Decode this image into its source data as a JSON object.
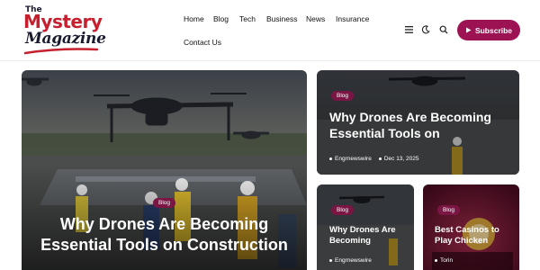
{
  "brand": {
    "logo_line1": "The",
    "logo_line2": "Mystery",
    "logo_line3": "Magazine",
    "accent": "#9c1253",
    "logo_red": "#c6202f"
  },
  "nav": {
    "items": [
      "Home",
      "Blog",
      "Tech",
      "Business",
      "News",
      "Insurance",
      "Contact Us"
    ]
  },
  "header_icons": [
    "menu-icon",
    "moon-icon",
    "search-icon"
  ],
  "subscribe": {
    "label": "Subscribe",
    "icon": "play-icon"
  },
  "featured": {
    "category": "Blog",
    "title": "Why Drones Are Becoming Essential Tools on Construction"
  },
  "side_top": {
    "category": "Blog",
    "title": "Why Drones Are Becoming Essential Tools on",
    "author": "Engrnewswire",
    "date": "Dec 13, 2025"
  },
  "small_left": {
    "category": "Blog",
    "title": "Why Drones Are Becoming",
    "author": "Engrnewswire"
  },
  "small_right": {
    "category": "Blog",
    "title": "Best Casinos to Play Chicken",
    "author": "Torin"
  }
}
